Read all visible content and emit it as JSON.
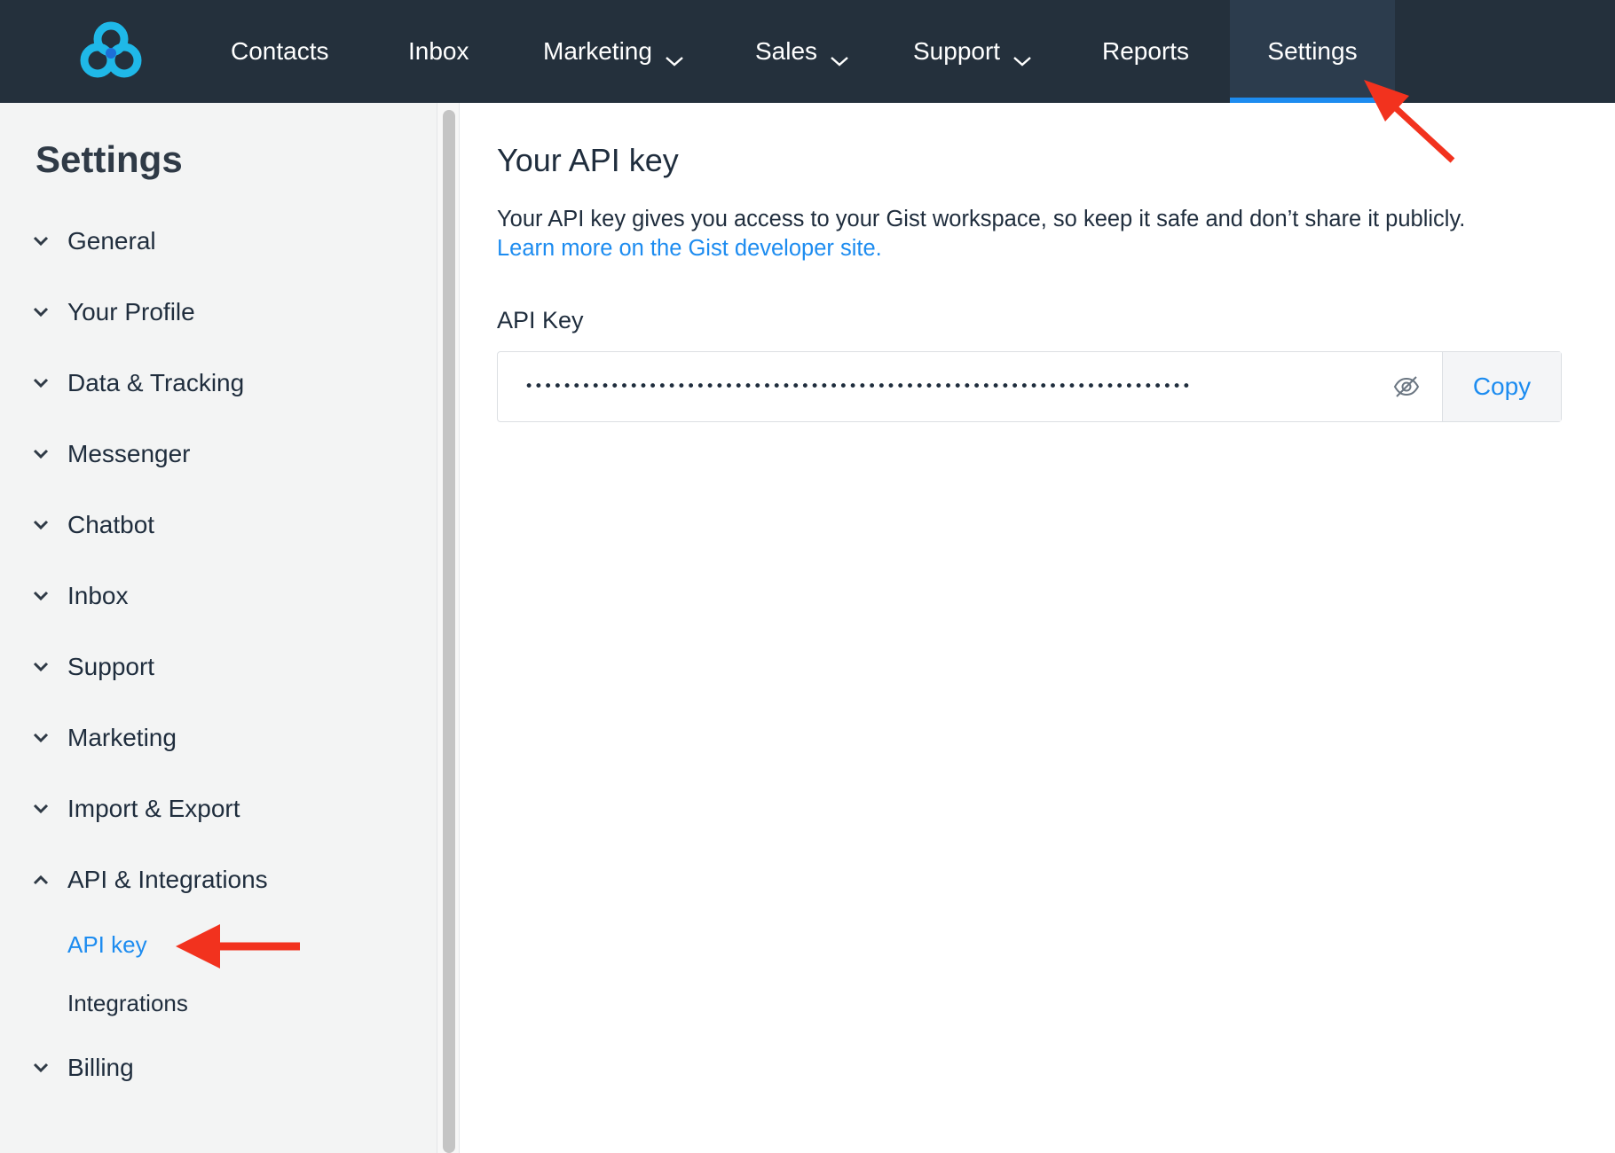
{
  "nav": {
    "items": [
      {
        "label": "Contacts",
        "dropdown": false,
        "active": false
      },
      {
        "label": "Inbox",
        "dropdown": false,
        "active": false
      },
      {
        "label": "Marketing",
        "dropdown": true,
        "active": false
      },
      {
        "label": "Sales",
        "dropdown": true,
        "active": false
      },
      {
        "label": "Support",
        "dropdown": true,
        "active": false
      },
      {
        "label": "Reports",
        "dropdown": false,
        "active": false
      },
      {
        "label": "Settings",
        "dropdown": false,
        "active": true
      }
    ]
  },
  "sidebar": {
    "title": "Settings",
    "items": [
      {
        "label": "General",
        "expanded": false
      },
      {
        "label": "Your Profile",
        "expanded": false
      },
      {
        "label": "Data & Tracking",
        "expanded": false
      },
      {
        "label": "Messenger",
        "expanded": false
      },
      {
        "label": "Chatbot",
        "expanded": false
      },
      {
        "label": "Inbox",
        "expanded": false
      },
      {
        "label": "Support",
        "expanded": false
      },
      {
        "label": "Marketing",
        "expanded": false
      },
      {
        "label": "Import & Export",
        "expanded": false
      },
      {
        "label": "API & Integrations",
        "expanded": true
      },
      {
        "label": "Billing",
        "expanded": false
      }
    ],
    "sub_items": [
      {
        "label": "API key",
        "active": true
      },
      {
        "label": "Integrations",
        "active": false
      }
    ]
  },
  "main": {
    "title": "Your API key",
    "description": "Your API key gives you access to your Gist workspace, so keep it safe and don’t share it publicly.",
    "link": "Learn more on the Gist developer site.",
    "field_label": "API Key",
    "key_value": "••••••••••••••••••••••••••••••••••••••••••••••••••••••••••••••••••••••",
    "copy_label": "Copy"
  },
  "colors": {
    "nav_bg": "#24303c",
    "accent": "#1d8cf0",
    "sidebar_bg": "#f3f4f4",
    "annotation": "#f2321e"
  },
  "icons": {
    "logo": "gist-logo-icon",
    "visibility": "eye-off-icon",
    "expand": "chevron-down-icon",
    "collapse": "chevron-up-icon"
  }
}
